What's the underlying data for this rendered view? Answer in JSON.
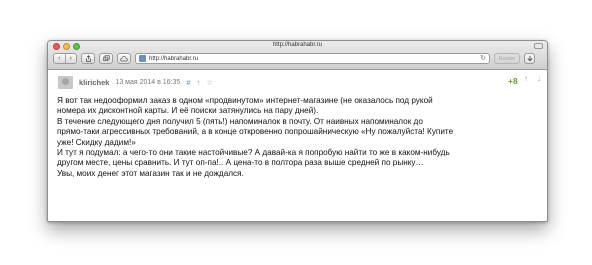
{
  "window": {
    "title": "http://habrahabr.ru"
  },
  "toolbar": {
    "back_icon": "‹",
    "forward_icon": "›",
    "url": "http://habrahabr.ru",
    "reload_icon": "↻",
    "reader_label": "Reader"
  },
  "comment": {
    "username": "klirichek",
    "date": "13 мая 2014 в 16:35",
    "anchor": "#",
    "up": "↑",
    "fav": "☆",
    "score": "+8",
    "vote_up": "↑",
    "vote_down": "↓",
    "lines": [
      "Я вот так недооформил заказ в одном «продвинутом» интернет-магазине (не оказалось под рукой",
      "номера их дисконтной карты. И её поиски затянулись на пару дней).",
      "В течение следующего дня получил 5 (пять!) напоминалок в почту. От наивных напоминалок до",
      "прямо-таки агрессивных требований, а в конце откровенно попрошайническую «Ну пожалуйста! Купите",
      "уже! Скидку дадим!»",
      "И тут я подумал: а чего-то они такие настойчивые? А давай-ка я попробую найти то же в каком-нибудь",
      "другом месте, цены сравнить. И тут оп-па!.. А цена-то в полтора раза выше средней по рынку…",
      "Увы, моих денег этот магазин так и не дождался."
    ]
  },
  "colors": {
    "score_green": "#6a9e2a",
    "link_blue": "#6d8fb3"
  }
}
